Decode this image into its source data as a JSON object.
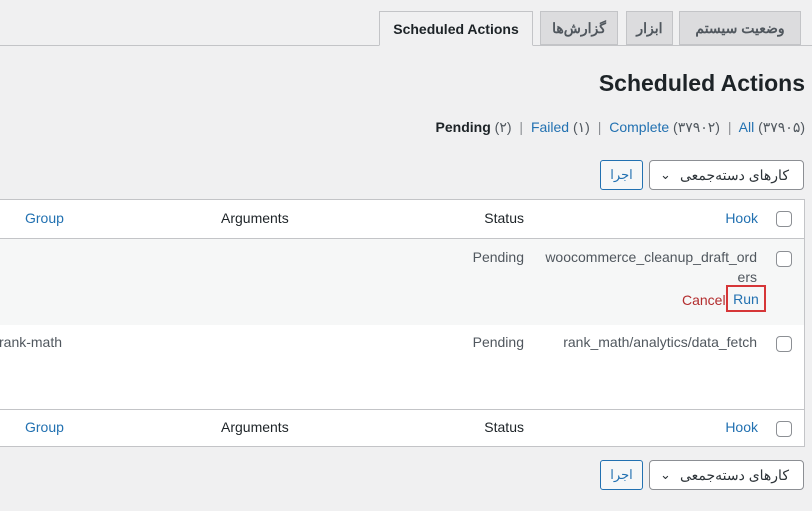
{
  "tabs": [
    {
      "label": "Scheduled Actions",
      "active": true
    },
    {
      "label": "گزارش‌ها",
      "active": false
    },
    {
      "label": "ابزار",
      "active": false
    },
    {
      "label": "وضعیت سیستم",
      "active": false
    }
  ],
  "page_title": "Scheduled Actions",
  "status_filters": {
    "all_label": "All",
    "all_count": "(۳۷۹۰۵)",
    "complete_label": "Complete",
    "complete_count": "(۳۷۹۰۲)",
    "failed_label": "Failed",
    "failed_count": "(۱)",
    "pending_label": "Pending",
    "pending_count": "(۲)",
    "separator": "|"
  },
  "bulk_actions": {
    "selected": "کارهای دسته‌جمعی",
    "apply_label": "اجرا"
  },
  "columns": {
    "hook": "Hook",
    "status": "Status",
    "arguments": "Arguments",
    "group": "Group"
  },
  "rows": [
    {
      "hook_line1": "woocommerce_cleanup_draft_ord",
      "hook_line2": "ers",
      "status": "Pending",
      "arguments": "",
      "group": "",
      "action_run": "Run",
      "action_cancel": "Cancel"
    },
    {
      "hook_line1": "rank_math/analytics/data_fetch",
      "status": "Pending",
      "arguments": "",
      "group": "rank-math"
    }
  ],
  "colors": {
    "accent": "#2271b1",
    "danger": "#b32d2e",
    "highlight_border": "#d63638",
    "background": "#f0f0f1"
  }
}
